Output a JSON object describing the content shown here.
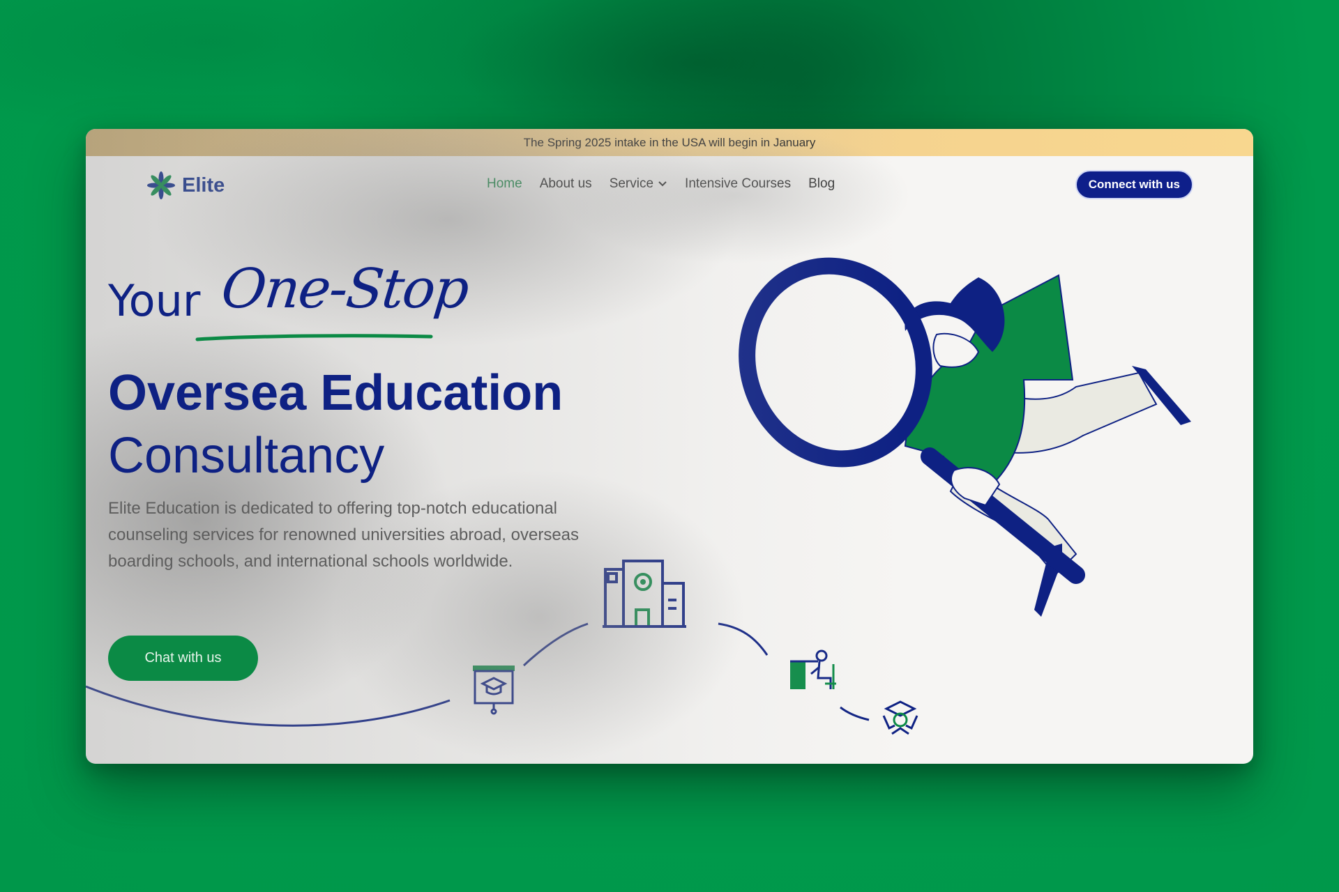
{
  "announcement": "The Spring 2025 intake in the USA will begin in January",
  "brand": {
    "name": "Elite"
  },
  "nav": {
    "items": [
      {
        "label": "Home",
        "active": true
      },
      {
        "label": "About us",
        "active": false
      },
      {
        "label": "Service",
        "active": false,
        "dropdown": true
      },
      {
        "label": "Intensive Courses",
        "active": false
      },
      {
        "label": "Blog",
        "active": false
      }
    ],
    "cta": "Connect with us"
  },
  "hero": {
    "line1_prefix": "Your",
    "line1_script": "One-Stop",
    "line2": "Oversea Education",
    "line3": "Consultancy",
    "description": "Elite Education is dedicated to offering top-notch educational counseling services for renowned universities abroad, overseas boarding schools, and international schools worldwide.",
    "cta": "Chat with us"
  },
  "icons": {
    "logo": "asterisk-flower-icon",
    "dropdown": "chevron-down-icon",
    "journey": [
      "presentation-graduation-icon",
      "school-building-icon",
      "student-desk-icon",
      "graduate-celebrating-icon"
    ],
    "hero_illustration": "woman-magnifying-glass-illustration"
  },
  "colors": {
    "navy": "#0e2183",
    "green": "#0b8a45",
    "announce_gold": "#f5d38f",
    "background_green": "#009a4c"
  }
}
